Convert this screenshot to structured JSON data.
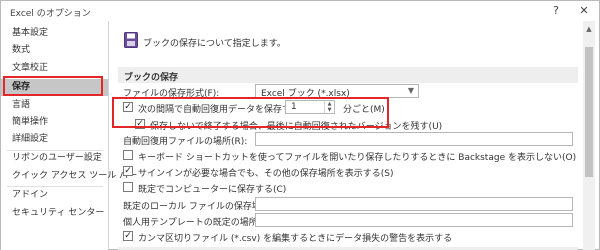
{
  "window": {
    "title": "Excel のオプション",
    "help": "?",
    "close": "✕"
  },
  "sidebar": {
    "items": [
      {
        "label": "基本設定"
      },
      {
        "label": "数式"
      },
      {
        "label": "文章校正"
      },
      {
        "label": "保存"
      },
      {
        "label": "言語"
      },
      {
        "label": "簡単操作"
      },
      {
        "label": "詳細設定"
      },
      {
        "label": "リボンのユーザー設定"
      },
      {
        "label": "クイック アクセス ツール バー"
      },
      {
        "label": "アドイン"
      },
      {
        "label": "セキュリティ センター"
      }
    ],
    "selected": "保存"
  },
  "content": {
    "header": "ブックの保存について指定します。",
    "section_title": "ブックの保存",
    "save_format_label": "ファイルの保存形式(F):",
    "save_format_value": "Excel ブック (*.xlsx)",
    "autorecover_label": "次の間隔で自動回復用データを保存する(A):",
    "autorecover_minutes": "1",
    "autorecover_unit": "分ごと(M)",
    "keep_last_label": "保存しないで終了する場合、最後に自動回復されたバージョンを残す(U)",
    "autorecover_location_label": "自動回復用ファイルの場所(R):",
    "no_backstage_label": "キーボード ショートカットを使ってファイルを開いたり保存したりするときに Backstage を表示しない(O)",
    "signin_label": "サインインが必要な場合でも、その他の保存場所を表示する(S)",
    "save_local_label": "既定でコンピューターに保存する(C)",
    "local_location_label": "既定のローカル ファイルの保存場所(I):",
    "template_location_label": "個人用テンプレートの既定の場所(T):",
    "csv_warning_label": "カンマ区切りファイル (*.csv) を編集するときにデータ損失の警告を表示する"
  }
}
